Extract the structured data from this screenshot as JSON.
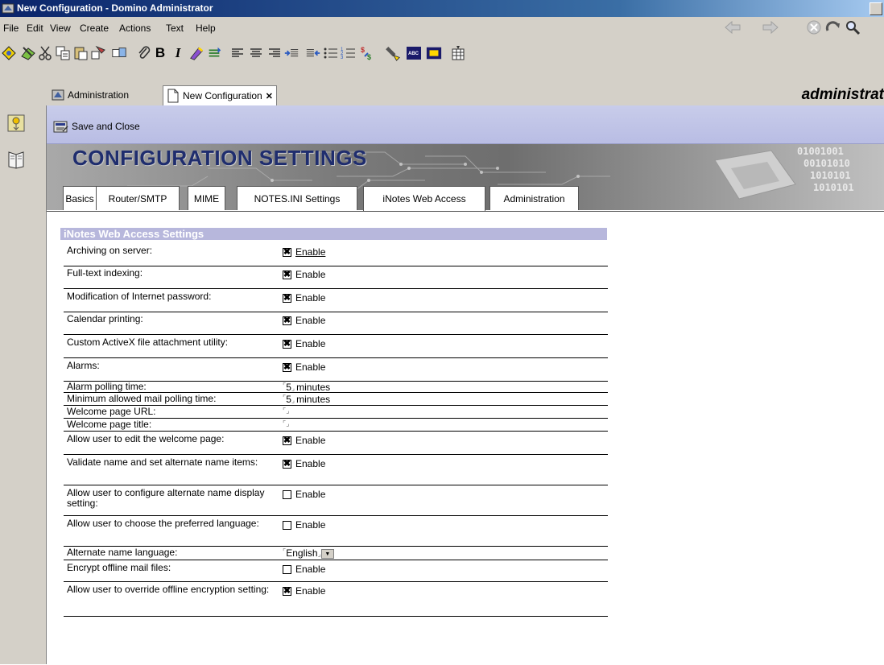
{
  "window": {
    "title": "New Configuration - Domino Administrator"
  },
  "menu": [
    "File",
    "Edit",
    "View",
    "Create",
    "Actions",
    "Text",
    "Help"
  ],
  "window_tabs": [
    {
      "label": "Administration",
      "icon": "admin-icon"
    },
    {
      "label": "New Configuration",
      "icon": "document-icon",
      "close": "✕"
    }
  ],
  "user_label": "administrat",
  "action_bar": {
    "save_close": "Save and Close"
  },
  "banner": {
    "title": "CONFIGURATION SETTINGS",
    "bits": [
      "01001001",
      "00101010",
      "1010101",
      "1010101"
    ]
  },
  "form_tabs": [
    "Basics",
    "Router/SMTP",
    "MIME",
    "NOTES.INI Settings",
    "iNotes Web Access",
    "Administration"
  ],
  "active_form_tab": 4,
  "section_title": "iNotes Web Access Settings",
  "rows": [
    {
      "label": "Archiving on server:",
      "type": "checkbox",
      "checked": true,
      "value": "Enable",
      "underlined": true
    },
    {
      "label": "Full-text indexing:",
      "type": "checkbox",
      "checked": true,
      "value": "Enable"
    },
    {
      "label": "Modification of Internet password:",
      "type": "checkbox",
      "checked": true,
      "value": "Enable"
    },
    {
      "label": "Calendar printing:",
      "type": "checkbox",
      "checked": true,
      "value": "Enable"
    },
    {
      "label": "Custom ActiveX file attachment utility:",
      "type": "checkbox",
      "checked": true,
      "value": "Enable"
    },
    {
      "label": "Alarms:",
      "type": "checkbox",
      "checked": true,
      "value": "Enable"
    },
    {
      "label": "Alarm polling time:",
      "type": "field",
      "value": "5",
      "suffix": "minutes"
    },
    {
      "label": "Minimum allowed mail polling time:",
      "type": "field",
      "value": "5",
      "suffix": "minutes"
    },
    {
      "label": "Welcome page URL:",
      "type": "field",
      "value": "",
      "suffix": ""
    },
    {
      "label": "Welcome page title:",
      "type": "field",
      "value": "",
      "suffix": ""
    },
    {
      "label": "Allow user to edit the welcome page:",
      "type": "checkbox",
      "checked": true,
      "value": "Enable"
    },
    {
      "label": "Validate name and set alternate name items:",
      "type": "checkbox",
      "checked": true,
      "value": "Enable"
    },
    {
      "label": "Allow user to configure alternate name display setting:",
      "type": "checkbox",
      "checked": false,
      "value": "Enable"
    },
    {
      "label": "Allow user to choose the preferred language:",
      "type": "checkbox",
      "checked": false,
      "value": "Enable"
    },
    {
      "label": "Alternate name language:",
      "type": "dropdown",
      "value": "English"
    },
    {
      "label": "Encrypt offline mail files:",
      "type": "checkbox",
      "checked": false,
      "value": "Enable"
    },
    {
      "label": "Allow user to override offline encryption setting:",
      "type": "checkbox",
      "checked": true,
      "value": "Enable"
    }
  ],
  "checkbox_mark": "✖",
  "colors": {
    "section_bar": "#b7b7dc",
    "title_bar": "#0a246a",
    "action_bar": "#c8ccea",
    "banner_title": "#1f2d6e"
  }
}
